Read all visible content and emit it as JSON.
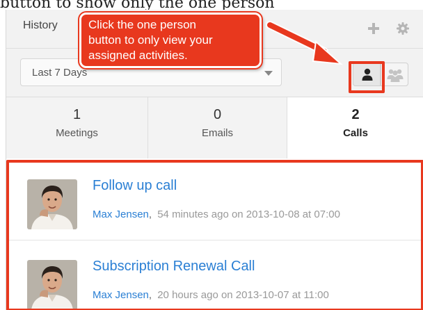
{
  "caption_fragment": "button to show only the one person",
  "header": {
    "title": "History",
    "plus_icon": "plus-icon",
    "gear_icon": "gear-icon"
  },
  "filter": {
    "selected": "Last 7 Days"
  },
  "view_buttons": {
    "me_icon": "single-person-icon",
    "group_icon": "group-icon"
  },
  "tabs": [
    {
      "count": "1",
      "label": "Meetings"
    },
    {
      "count": "0",
      "label": "Emails"
    },
    {
      "count": "2",
      "label": "Calls"
    }
  ],
  "items": [
    {
      "title": "Follow up call",
      "author": "Max Jensen",
      "separator": ",",
      "meta": "54 minutes ago on 2013-10-08 at 07:00"
    },
    {
      "title": "Subscription Renewal Call",
      "author": "Max Jensen",
      "separator": ",",
      "meta": "20 hours ago on 2013-10-07 at 11:00"
    }
  ],
  "callout": {
    "lines": [
      "Click the one person",
      "button to only view your",
      "assigned activities."
    ]
  },
  "colors": {
    "accent": "#e8381e",
    "link": "#2a7fd4"
  }
}
